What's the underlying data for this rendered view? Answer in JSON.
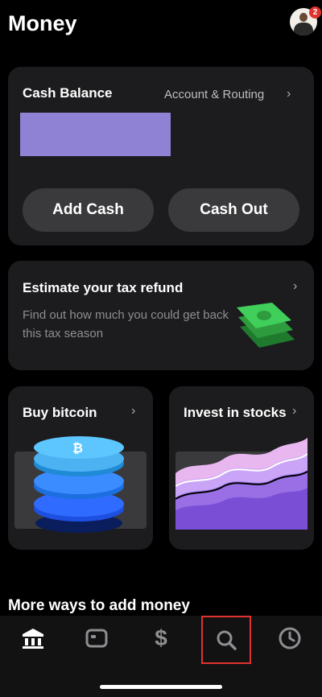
{
  "header": {
    "title": "Money",
    "notification_count": "2"
  },
  "balance_card": {
    "title": "Cash Balance",
    "account_link": "Account & Routing",
    "balance_redaction_color": "#8f81d3",
    "add_cash_label": "Add Cash",
    "cash_out_label": "Cash Out"
  },
  "tax_card": {
    "title": "Estimate your tax refund",
    "description": "Find out how much you could get back this tax season"
  },
  "bitcoin_card": {
    "title": "Buy bitcoin"
  },
  "stocks_card": {
    "title": "Invest in stocks"
  },
  "more_ways": {
    "title": "More ways to add money"
  },
  "nav": {
    "items": [
      "bank-icon",
      "card-icon",
      "dollar-icon",
      "search-icon",
      "clock-icon"
    ],
    "selected": "search-icon"
  },
  "colors": {
    "background": "#000000",
    "card": "#1c1c1e",
    "button": "#3a3a3c",
    "highlight": "#e0332f"
  }
}
